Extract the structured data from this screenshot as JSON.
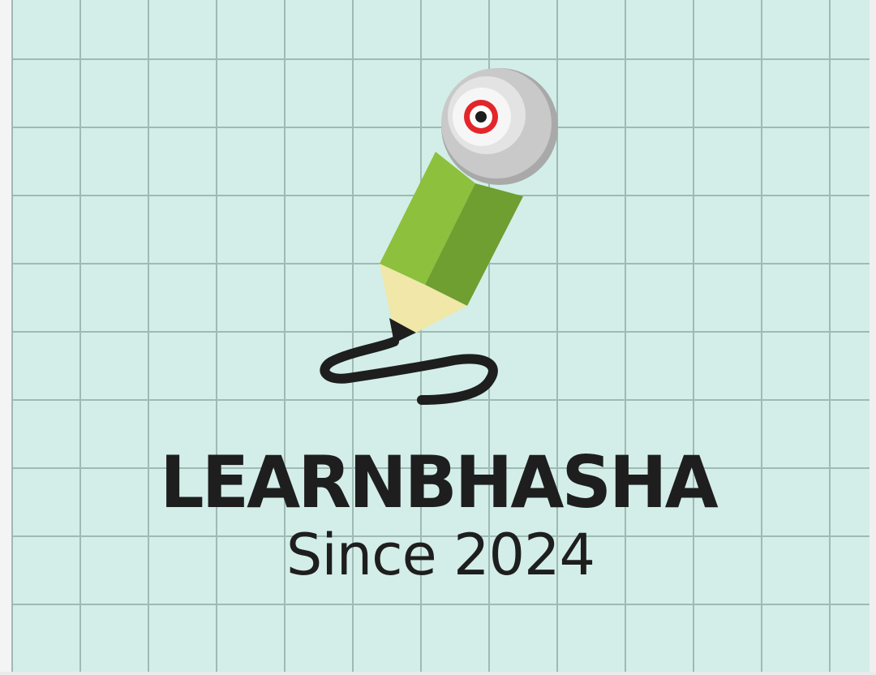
{
  "logo": {
    "brand_name": "LEARNBHASHA",
    "tagline": "Since 2024",
    "icon": "pencil-with-lens-icon"
  },
  "colors": {
    "background": "#d3eee8",
    "grid_lines": "#9fb9b3",
    "pencil_green_light": "#8dc03c",
    "pencil_green_dark": "#6f9e31",
    "pencil_wood": "#f0e7a8",
    "lens_gray": "#c9c9c9",
    "lens_target_red": "#e3262b",
    "text": "#1e1e1e"
  }
}
